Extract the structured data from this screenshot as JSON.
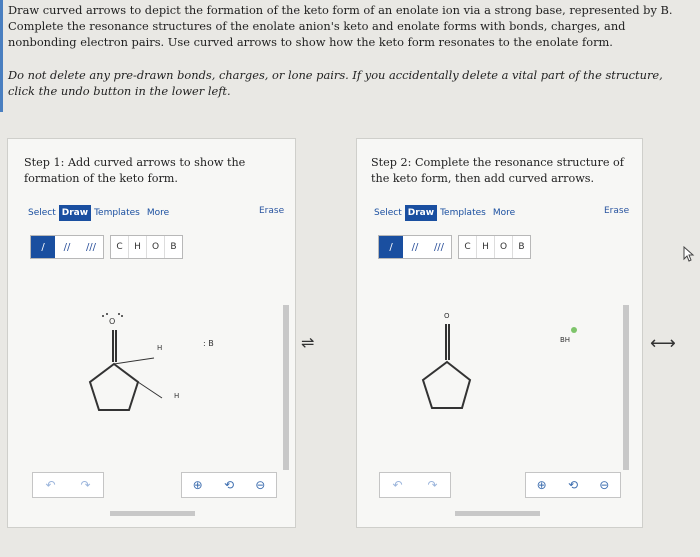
{
  "instructions": {
    "main": "Draw curved arrows to depict the formation of the keto form of an enolate ion via a strong base, represented by B. Complete the resonance structures of the enolate anion's keto and enolate forms with bonds, charges, and nonbonding electron pairs. Use curved arrows to show how the keto form resonates to the enolate form.",
    "note": "Do not delete any pre-drawn bonds, charges, or lone pairs. If you accidentally delete a vital part of the structure, click the undo button in the lower left."
  },
  "step1": {
    "title": "Step 1: Add curved arrows to show the formation of the keto form.",
    "tabs": {
      "select": "Select",
      "draw": "Draw",
      "templates": "Templates",
      "more": "More"
    },
    "erase": "Erase",
    "tools": [
      "/",
      "//",
      "///"
    ],
    "atoms": [
      "C",
      "H",
      "O",
      "B"
    ],
    "molecule_labels": {
      "oxygen": "O",
      "h1": "H",
      "h2": "H",
      "base": ": B"
    }
  },
  "resonance_arrow": "⇌",
  "step2": {
    "title": "Step 2: Complete the resonance structure of the keto form, then add curved arrows.",
    "tabs": {
      "select": "Select",
      "draw": "Draw",
      "templates": "Templates",
      "more": "More"
    },
    "erase": "Erase",
    "tools": [
      "/",
      "//",
      "///"
    ],
    "atoms": [
      "C",
      "H",
      "O",
      "B"
    ],
    "molecule_labels": {
      "oxygen": "O",
      "bh": "BH"
    }
  },
  "double_arrow": "⟷",
  "icons": {
    "undo": "undo-icon",
    "redo": "redo-icon",
    "zoom_in": "zoom-in-icon",
    "reset": "reset-icon",
    "zoom_out": "zoom-out-icon"
  },
  "colors": {
    "accent": "#1a4fa0",
    "charge": "#7ec46a"
  }
}
